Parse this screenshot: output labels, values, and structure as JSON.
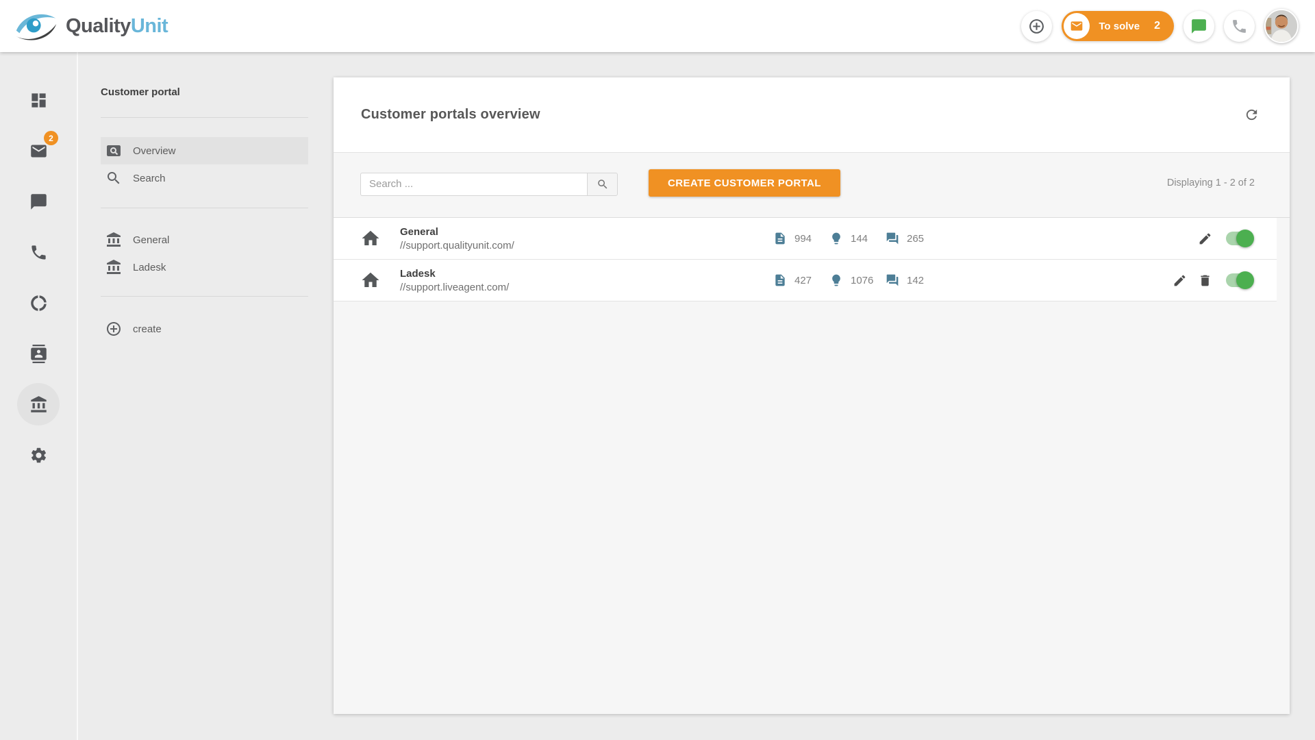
{
  "brand": {
    "name_primary": "Quality",
    "name_secondary": "Unit"
  },
  "header": {
    "to_solve_label": "To solve",
    "to_solve_count": "2",
    "icons": [
      "add-icon",
      "envelope-icon",
      "chat-icon",
      "phone-icon",
      "avatar"
    ]
  },
  "sidebar": {
    "mail_badge": "2",
    "icons": [
      "dashboard-icon",
      "mail-icon",
      "chat-icon",
      "phone-icon",
      "reports-donut-icon",
      "contacts-icon",
      "customer-portal-bank-icon",
      "settings-gear-icon"
    ],
    "active_icon": "customer-portal-bank-icon"
  },
  "submenu": {
    "title": "Customer portal",
    "items": [
      {
        "label": "Overview",
        "icon": "pageview-icon",
        "active": true
      },
      {
        "label": "Search",
        "icon": "search-icon",
        "active": false
      }
    ],
    "portals": [
      {
        "label": "General",
        "icon": "bank-icon"
      },
      {
        "label": "Ladesk",
        "icon": "bank-icon"
      }
    ],
    "create_label": "create"
  },
  "main": {
    "title": "Customer portals overview",
    "search_placeholder": "Search ...",
    "create_button": "CREATE CUSTOMER PORTAL",
    "displaying": "Displaying 1 - 2 of 2",
    "rows": [
      {
        "name": "General",
        "url": "//support.qualityunit.com/",
        "articles": "994",
        "suggestions": "144",
        "forum_topics": "265",
        "enabled": true,
        "deletable": false
      },
      {
        "name": "Ladesk",
        "url": "//support.liveagent.com/",
        "articles": "427",
        "suggestions": "1076",
        "forum_topics": "142",
        "enabled": true,
        "deletable": true
      }
    ]
  },
  "colors": {
    "accent_orange": "#f09123",
    "logo_blue": "#69b6d9",
    "toggle_green": "#4caf50",
    "stat_icon_teal": "#4d7e96",
    "chat_green": "#4caf50",
    "page_bg": "#ececec",
    "panel_bg": "#f6f6f6"
  }
}
